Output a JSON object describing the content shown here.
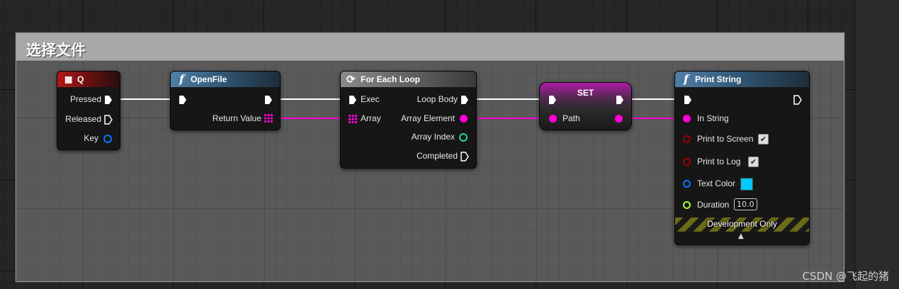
{
  "comment": {
    "title": "选择文件"
  },
  "nodes": {
    "q": {
      "title": "Q",
      "pins": {
        "pressed": "Pressed",
        "released": "Released",
        "key": "Key"
      }
    },
    "openfile": {
      "title": "OpenFile",
      "pins": {
        "return_value": "Return Value"
      }
    },
    "foreach": {
      "title": "For Each Loop",
      "pins": {
        "exec": "Exec",
        "array": "Array",
        "loop_body": "Loop Body",
        "array_element": "Array Element",
        "array_index": "Array Index",
        "completed": "Completed"
      }
    },
    "set": {
      "title": "SET",
      "pins": {
        "path": "Path"
      }
    },
    "printstring": {
      "title": "Print String",
      "pins": {
        "in_string": "In String",
        "print_to_screen": "Print to Screen",
        "print_to_log": "Print to Log",
        "text_color": "Text Color",
        "duration": "Duration"
      },
      "duration_value": "10.0",
      "development_only": "Development Only",
      "print_to_screen_checked": true,
      "print_to_log_checked": true,
      "text_color_value": "#00c8ff"
    }
  },
  "colors": {
    "exec": "#ffffff",
    "string": "#ff00d4",
    "struct": "#0078ff",
    "int": "#22d6a0",
    "bool": "#a00000",
    "float": "#a0ff40"
  },
  "icons": {
    "function": "function-icon",
    "key_event": "keyboard-icon",
    "loop": "loop-icon"
  },
  "watermark": "CSDN @飞起的猪"
}
